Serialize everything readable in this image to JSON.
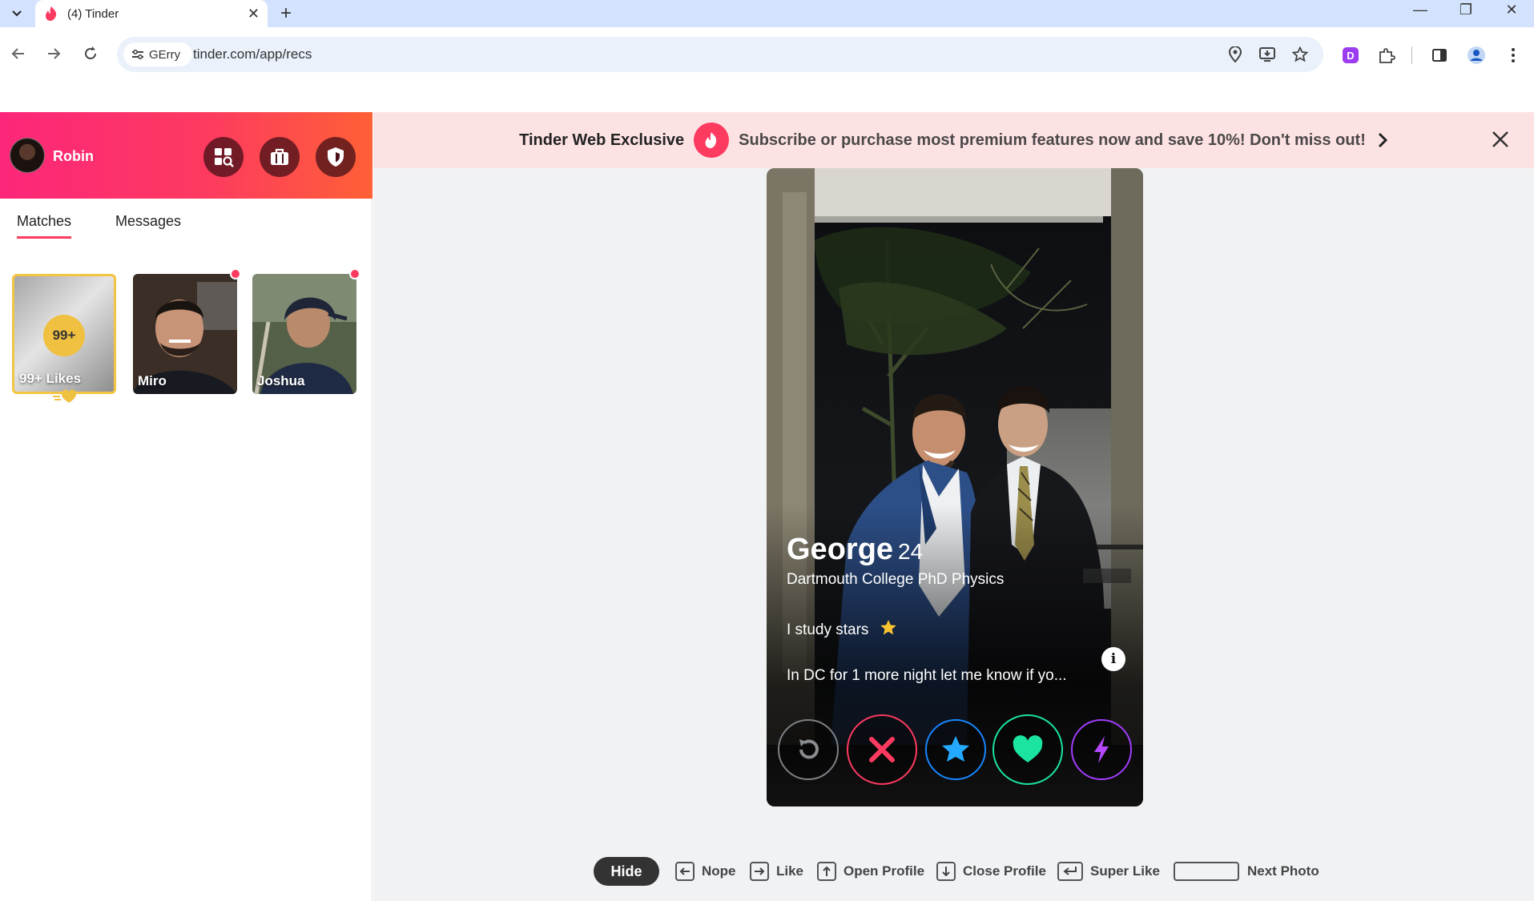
{
  "browser": {
    "tab_title": "(4) Tinder",
    "site_chip": "GErry",
    "url": "tinder.com/app/recs"
  },
  "sidebar": {
    "user_name": "Robin",
    "tabs": [
      {
        "label": "Matches",
        "active": true
      },
      {
        "label": "Messages",
        "active": false
      }
    ],
    "likes": {
      "badge": "99+",
      "label": "99+ Likes"
    },
    "matches": [
      {
        "name": "Miro",
        "unread": true
      },
      {
        "name": "Joshua",
        "unread": true
      }
    ]
  },
  "banner": {
    "title": "Tinder Web Exclusive",
    "text": "Subscribe or purchase most premium features now and save 10%! Don't miss out!"
  },
  "profile": {
    "name": "George",
    "age": "24",
    "school": "Dartmouth College PhD Physics",
    "bio_line1": "I study stars",
    "bio_line2": "In DC for 1 more night let me know if yo..."
  },
  "actions": [
    "rewind-icon",
    "nope-x-icon",
    "super-like-star-icon",
    "like-heart-icon",
    "boost-bolt-icon"
  ],
  "shortcuts": {
    "hide": "Hide",
    "nope": "Nope",
    "like": "Like",
    "open_profile": "Open Profile",
    "close_profile": "Close Profile",
    "super_like": "Super Like",
    "next_photo": "Next Photo"
  },
  "colors": {
    "brand_pink": "#fd267a",
    "brand_orange": "#ff6036",
    "nope_red": "#fd3a60",
    "super_blue": "#1786ff",
    "like_green": "#1be4a1",
    "boost_purple": "#a03dfc",
    "likes_gold": "#f0c040"
  }
}
